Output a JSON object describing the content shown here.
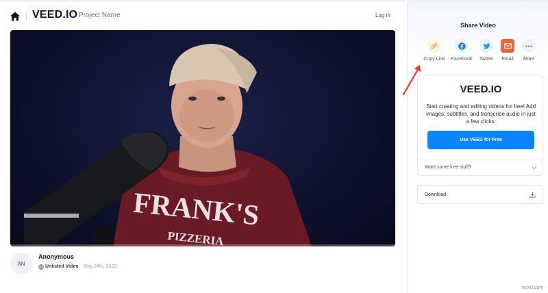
{
  "header": {
    "logo": "VEED.IO",
    "project_name": "Project Name",
    "login_label": "Log in"
  },
  "video": {
    "progress": 0
  },
  "meta": {
    "avatar_initials": "AN",
    "author": "Anonymous",
    "visibility": "Unlisted Video",
    "date": "May 24th, 2022"
  },
  "share": {
    "title": "Share Video",
    "buttons": [
      {
        "label": "Copy Link",
        "icon": "link-icon",
        "color": "#f5a623",
        "bg": "#fff3e0"
      },
      {
        "label": "Facebook",
        "icon": "facebook-icon",
        "color": "#1877f2",
        "bg": "#e8f1fe"
      },
      {
        "label": "Twitter",
        "icon": "twitter-icon",
        "color": "#1d9bf0",
        "bg": "#e6f4fd"
      },
      {
        "label": "Email",
        "icon": "mail-icon",
        "color": "#ffffff",
        "bg": "#f0643a"
      },
      {
        "label": "More",
        "icon": "more-icon",
        "color": "#4b5563",
        "bg": "#f0f1f4"
      }
    ]
  },
  "promo": {
    "logo": "VEED.IO",
    "text": "Start creating and editing videos for free! Add images, subtitles, and transcribe audio in just a few clicks.",
    "cta_label": "Use VEED for Free",
    "free_stuff_label": "Want some free stuff?"
  },
  "download": {
    "label": "Download"
  },
  "watermark": "wtvid.com",
  "colors": {
    "accent": "#0a84ff",
    "annotation_arrow": "#e8381e"
  }
}
